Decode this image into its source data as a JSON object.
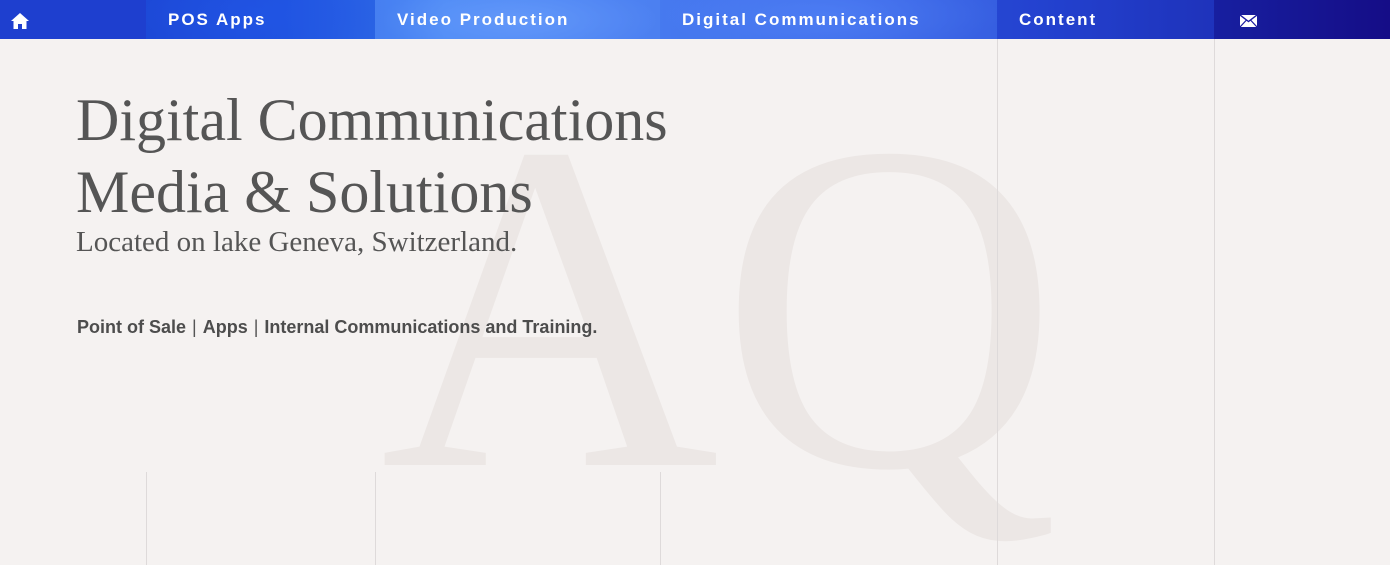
{
  "nav": {
    "home_icon": "home-icon",
    "items": [
      {
        "label": "POS Apps"
      },
      {
        "label": "Video Production"
      },
      {
        "label": "Digital Communications"
      },
      {
        "label": "Content"
      }
    ],
    "mail_icon": "mail-icon",
    "colors": {
      "bar_start": "#1c35c8",
      "bar_end": "#160f8a",
      "text": "#ffffff"
    }
  },
  "hero": {
    "headline_line1": "Digital Communications",
    "headline_line2": "Media & Solutions",
    "subline": "Located on lake Geneva, Switzerland.",
    "services": [
      "Point of Sale",
      "Apps",
      "Internal Communications and Training."
    ],
    "separator": "|",
    "watermark_letters": "AQ"
  },
  "colors": {
    "background": "#f5f2f1",
    "text": "#555555",
    "watermark": "#ebe6e4"
  }
}
